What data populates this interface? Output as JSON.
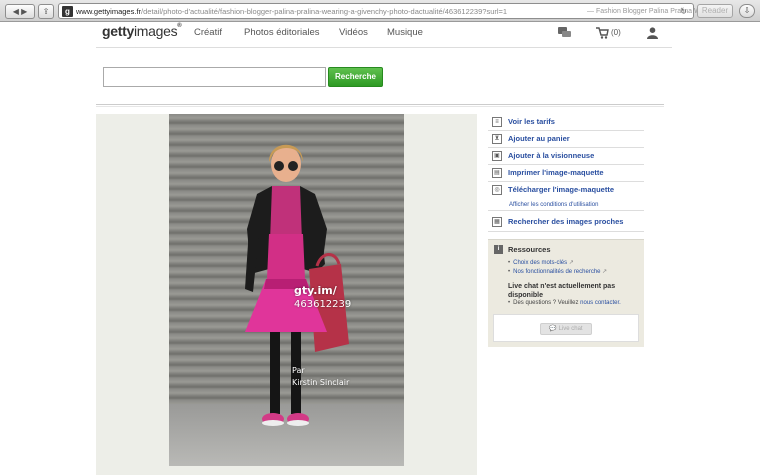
{
  "browser": {
    "url_domain": "www.gettyimages.fr",
    "url_path": "/detail/photo-d'actualité/fashion-blogger-palina-pralina-wearing-a-givenchy-photo-dactualité/463612239?surl=1",
    "page_title": "— Fashion Blogger Palina Pralina Wea…",
    "reader_label": "Reader"
  },
  "header": {
    "logo_bold": "getty",
    "logo_light": "images",
    "logo_mark": "®",
    "nav": [
      "Créatif",
      "Photos éditoriales",
      "Vidéos",
      "Musique"
    ],
    "cart_count": "(0)"
  },
  "search": {
    "value": "",
    "button_label": "Recherche"
  },
  "photo": {
    "watermark_brand": "gty.im/",
    "watermark_id": "463612239",
    "credit_prefix": "Par",
    "credit_name": "Kirstin Sinclair"
  },
  "actions": [
    {
      "label": "Voir les tarifs",
      "icon": "price-list-icon"
    },
    {
      "label": "Ajouter au panier",
      "icon": "cart-icon"
    },
    {
      "label": "Ajouter à la visionneuse",
      "icon": "lightbox-icon"
    },
    {
      "label": "Imprimer l'image-maquette",
      "icon": "print-icon"
    },
    {
      "label": "Télécharger l'image-maquette",
      "icon": "download-icon"
    }
  ],
  "conditions_link": "Afficher les conditions d'utilisation",
  "similar_link": "Rechercher des images proches",
  "resources": {
    "title": "Ressources",
    "links": [
      "Choix des mots-clés",
      "Nos fonctionnalités de recherche"
    ],
    "chat_title": "Live chat n'est actuellement pas disponible",
    "chat_question": "Des questions ? Veuillez",
    "chat_contact": "nous contacter.",
    "chat_button": "Live chat"
  }
}
